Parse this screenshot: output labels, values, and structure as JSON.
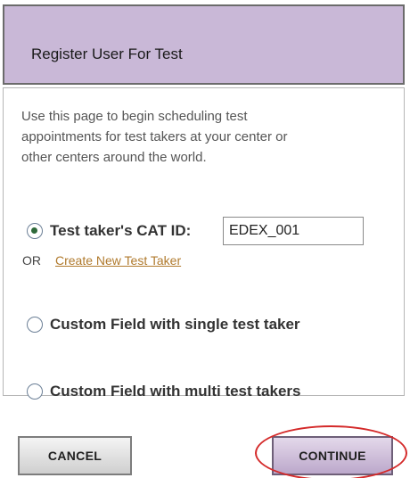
{
  "header": {
    "title": "Register User For Test"
  },
  "intro": {
    "text": "Use this page to begin scheduling test appointments for test takers at your center or other centers around the world."
  },
  "options": {
    "cat_id": {
      "label": "Test taker's CAT ID:",
      "value": "EDEX_001",
      "selected": true
    },
    "or_label": "OR",
    "create_link": "Create New Test Taker",
    "single": {
      "label": "Custom Field with single test taker",
      "selected": false
    },
    "multi": {
      "label": "Custom Field with multi test takers",
      "selected": false
    }
  },
  "buttons": {
    "cancel": "CANCEL",
    "continue": "CONTINUE"
  },
  "colors": {
    "header_bg": "#c9b8d7",
    "link": "#b07a2d",
    "highlight": "#d42a2a"
  }
}
